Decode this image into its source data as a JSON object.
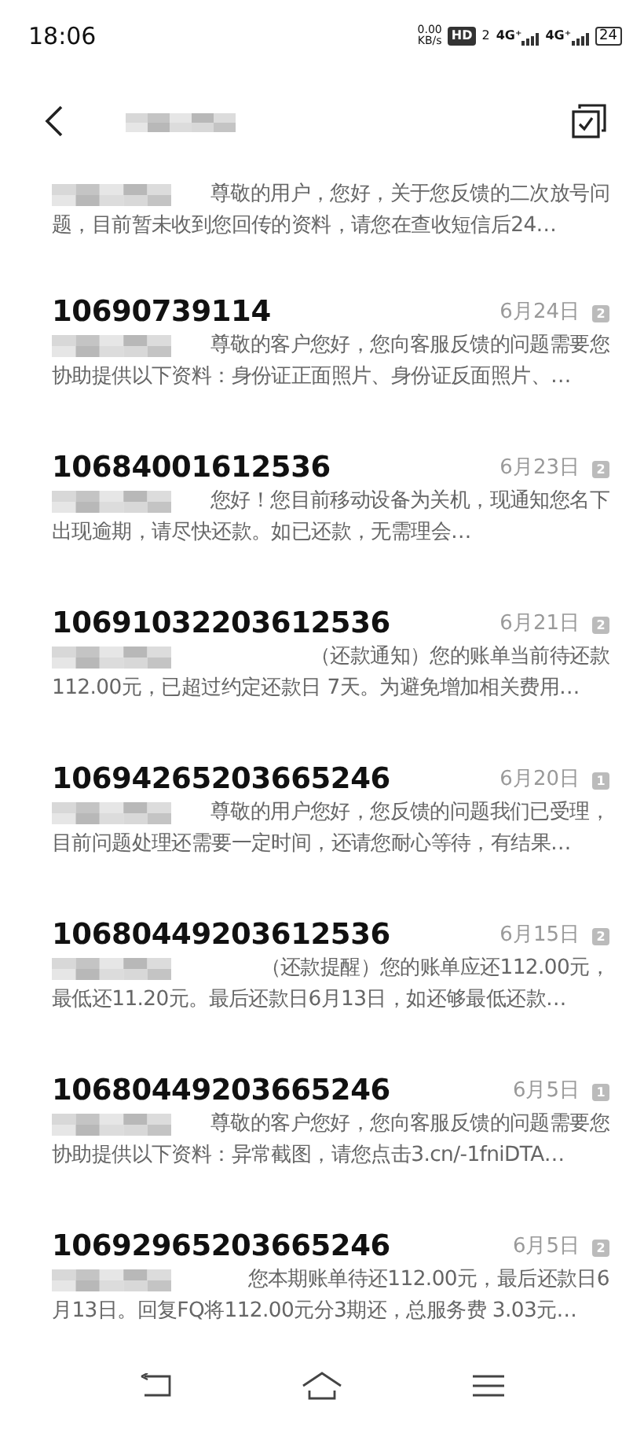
{
  "status_bar": {
    "time": "18:06",
    "net_speed": "0.00",
    "net_unit": "KB/s",
    "hd": "HD",
    "hd_sim": "2",
    "networks": [
      "4G⁺",
      "4G⁺"
    ],
    "battery": "24"
  },
  "messages": [
    {
      "preview_lines": [
        "尊敬的用户，您好，关于您反馈的二次放号问",
        "题，目前暂未收到您回传的资料，请您在查收短信后24…"
      ]
    },
    {
      "sender": "10690739114",
      "date": "6月24日",
      "sim": "2",
      "preview_lines": [
        "尊敬的客户您好，您向客服反馈的问题需要您",
        "协助提供以下资料：身份证正面照片、身份证反面照片、…"
      ]
    },
    {
      "sender": "10684001612536",
      "date": "6月23日",
      "sim": "2",
      "preview_lines": [
        "您好！您目前移动设备为关机，现通知您名下",
        "出现逾期，请尽快还款。如已还款，无需理会…"
      ]
    },
    {
      "sender": "10691032203612536",
      "date": "6月21日",
      "sim": "2",
      "preview_lines": [
        "（还款通知）您的账单当前待还款",
        "112.00元，已超过约定还款日 7天。为避免增加相关费用…"
      ]
    },
    {
      "sender": "10694265203665246",
      "date": "6月20日",
      "sim": "1",
      "preview_lines": [
        "尊敬的用户您好，您反馈的问题我们已受理，",
        "目前问题处理还需要一定时间，还请您耐心等待，有结果…"
      ]
    },
    {
      "sender": "10680449203612536",
      "date": "6月15日",
      "sim": "2",
      "preview_lines": [
        "（还款提醒）您的账单应还112.00元，",
        "最低还11.20元。最后还款日6月13日，如还够最低还款…"
      ]
    },
    {
      "sender": "10680449203665246",
      "date": "6月5日",
      "sim": "1",
      "preview_lines": [
        "尊敬的客户您好，您向客服反馈的问题需要您",
        "协助提供以下资料：异常截图，请您点击3.cn/-1fniDTA…"
      ]
    },
    {
      "sender": "10692965203665246",
      "date": "6月5日",
      "sim": "2",
      "preview_lines": [
        "您本期账单待还112.00元，最后还款日6",
        "月13日。回复FQ将112.00元分3期还，总服务费 3.03元…"
      ]
    }
  ]
}
